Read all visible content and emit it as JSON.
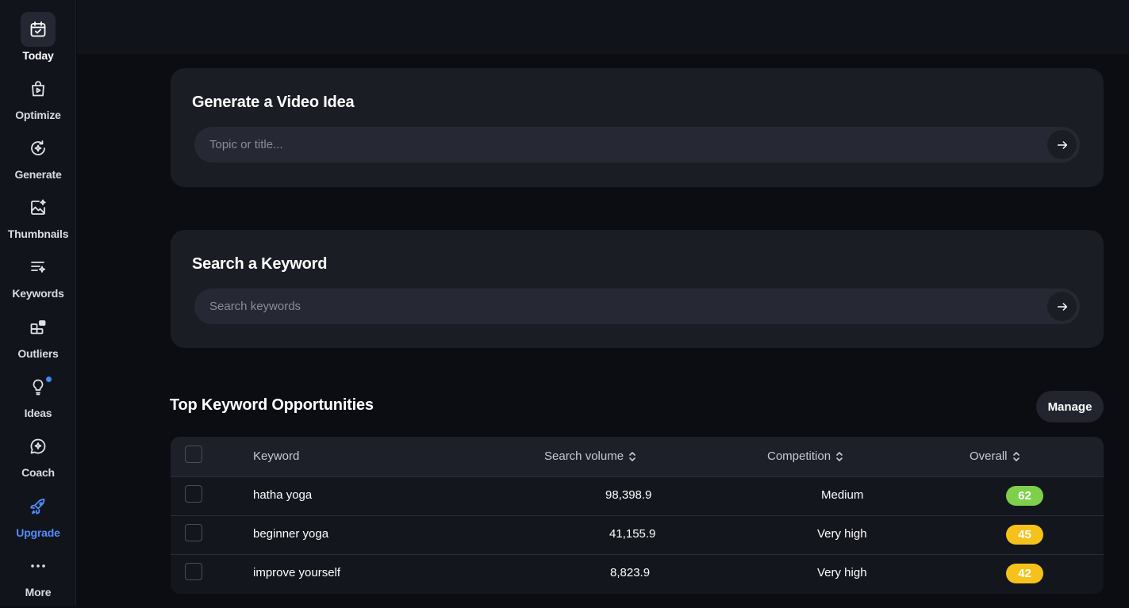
{
  "nav": {
    "items": [
      {
        "label": "Today",
        "icon": "calendar-check-icon"
      },
      {
        "label": "Optimize",
        "icon": "play-bag-icon"
      },
      {
        "label": "Generate",
        "icon": "refresh-sparkle-icon"
      },
      {
        "label": "Thumbnails",
        "icon": "image-sparkle-icon"
      },
      {
        "label": "Keywords",
        "icon": "list-sparkle-icon"
      },
      {
        "label": "Outliers",
        "icon": "blocks-icon"
      },
      {
        "label": "Ideas",
        "icon": "lightbulb-icon"
      },
      {
        "label": "Coach",
        "icon": "chat-sparkle-icon"
      },
      {
        "label": "Upgrade",
        "icon": "rocket-icon"
      },
      {
        "label": "More",
        "icon": "more-dots-icon"
      }
    ],
    "active": "Today"
  },
  "video_idea": {
    "title": "Generate a Video Idea",
    "placeholder": "Topic or title..."
  },
  "keyword_search": {
    "title": "Search a Keyword",
    "placeholder": "Search keywords"
  },
  "opportunities": {
    "title": "Top Keyword Opportunities",
    "manage_label": "Manage",
    "columns": {
      "keyword": "Keyword",
      "search_volume": "Search volume",
      "competition": "Competition",
      "overall": "Overall"
    },
    "rows": [
      {
        "keyword": "hatha yoga",
        "search_volume": "98,398.9",
        "competition": "Medium",
        "overall": "62"
      },
      {
        "keyword": "beginner yoga",
        "search_volume": "41,155.9",
        "competition": "Very high",
        "overall": "45"
      },
      {
        "keyword": "improve yourself",
        "search_volume": "8,823.9",
        "competition": "Very high",
        "overall": "42"
      }
    ]
  },
  "colors": {
    "accent_blue": "#4f8dff",
    "score_green": "#7ed04a",
    "score_yellow": "#f5c21b"
  }
}
